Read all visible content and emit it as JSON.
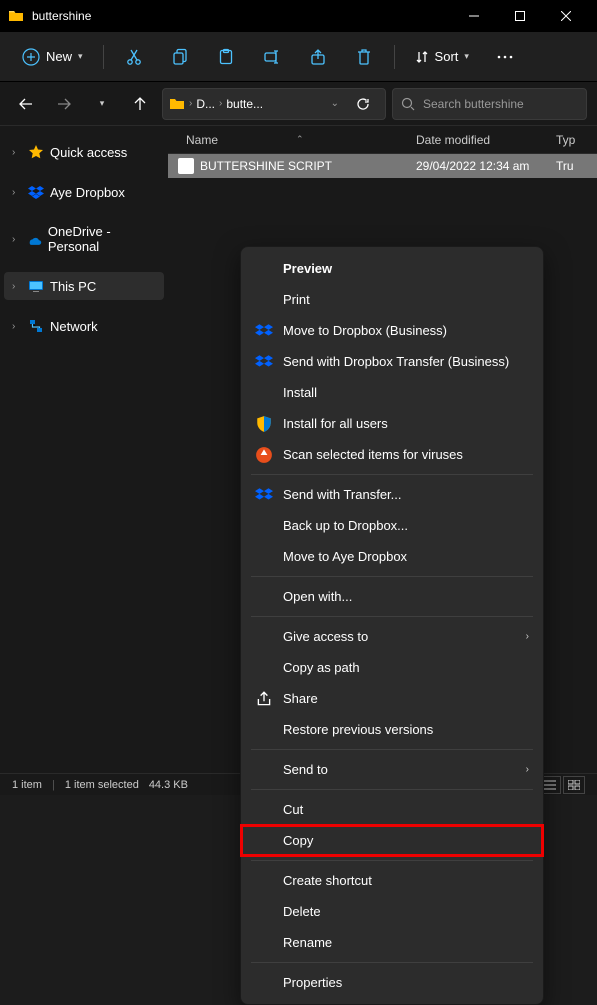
{
  "window": {
    "title": "buttershine"
  },
  "toolbar": {
    "new_label": "New",
    "sort_label": "Sort"
  },
  "breadcrumb": {
    "parts": [
      "D...",
      "butte..."
    ]
  },
  "search": {
    "placeholder": "Search buttershine"
  },
  "sidebar": {
    "items": [
      {
        "label": "Quick access",
        "icon": "star"
      },
      {
        "label": "Aye Dropbox",
        "icon": "dropbox"
      },
      {
        "label": "OneDrive - Personal",
        "icon": "onedrive"
      },
      {
        "label": "This PC",
        "icon": "pc"
      },
      {
        "label": "Network",
        "icon": "network"
      }
    ]
  },
  "columns": {
    "name": "Name",
    "date": "Date modified",
    "type": "Typ"
  },
  "files": [
    {
      "name": "BUTTERSHINE SCRIPT",
      "date": "29/04/2022 12:34 am",
      "type": "Tru"
    }
  ],
  "status": {
    "count": "1 item",
    "selection": "1 item selected",
    "size": "44.3 KB"
  },
  "context_menu": {
    "preview": "Preview",
    "print": "Print",
    "move_dropbox_biz": "Move to Dropbox (Business)",
    "send_dropbox_transfer_biz": "Send with Dropbox Transfer (Business)",
    "install": "Install",
    "install_all": "Install for all users",
    "scan_viruses": "Scan selected items for viruses",
    "send_transfer": "Send with Transfer...",
    "back_up_dropbox": "Back up to Dropbox...",
    "move_aye_dropbox": "Move to Aye Dropbox",
    "open_with": "Open with...",
    "give_access": "Give access to",
    "copy_as_path": "Copy as path",
    "share": "Share",
    "restore_versions": "Restore previous versions",
    "send_to": "Send to",
    "cut": "Cut",
    "copy": "Copy",
    "create_shortcut": "Create shortcut",
    "delete": "Delete",
    "rename": "Rename",
    "properties": "Properties"
  }
}
